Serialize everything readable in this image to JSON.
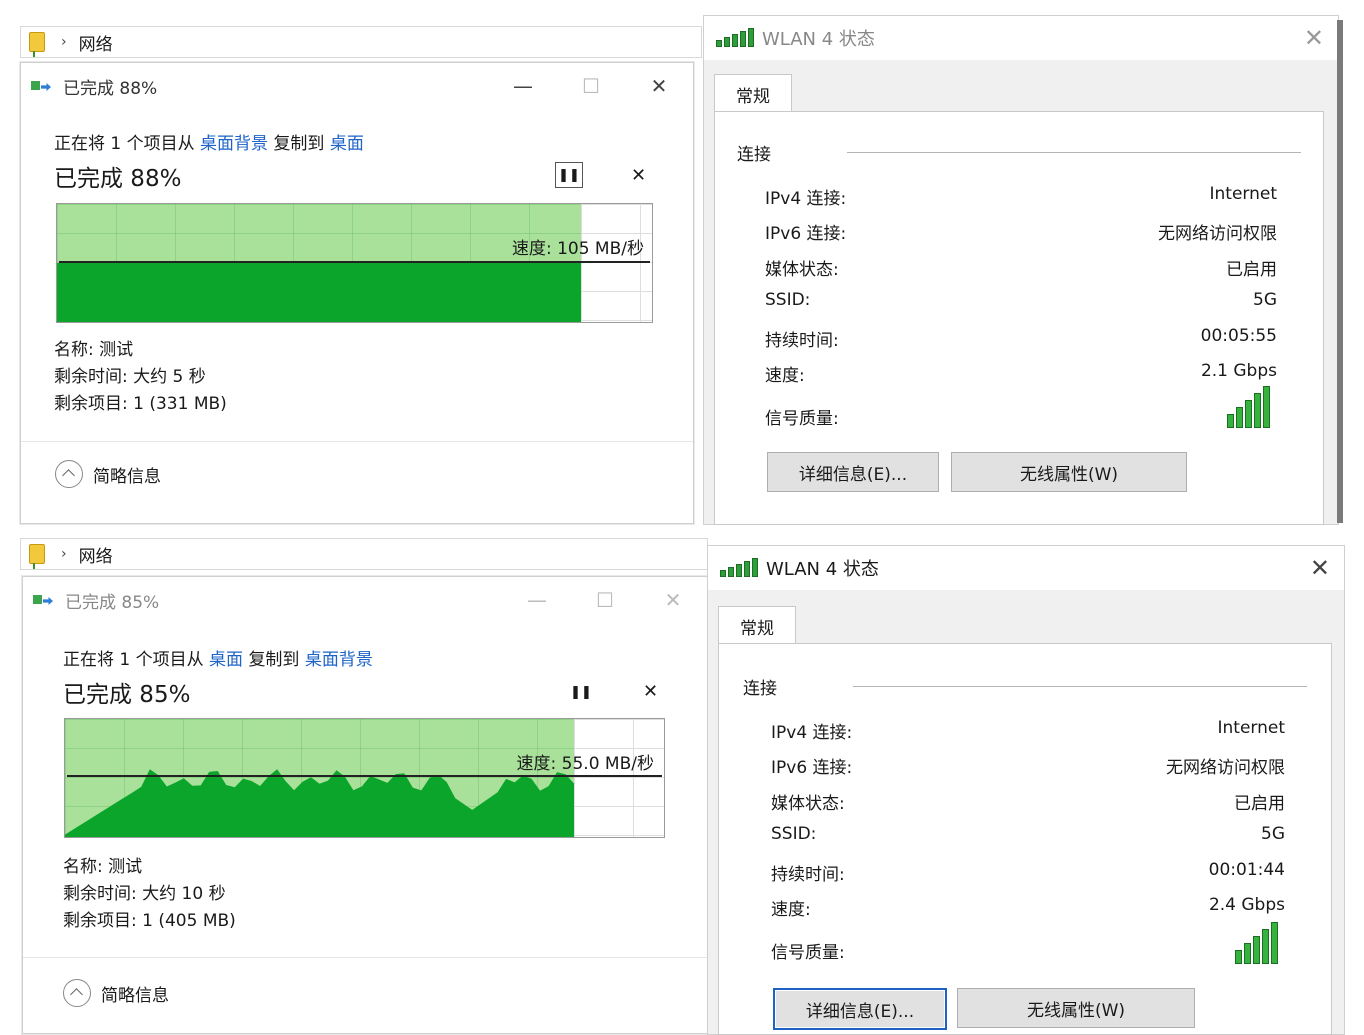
{
  "top_explorer": {
    "breadcrumb": "网络"
  },
  "bottom_explorer": {
    "breadcrumb": "网络"
  },
  "copy_top": {
    "title": "已完成 88%",
    "op_prefix": "正在将 1 个项目从",
    "source": "桌面背景",
    "op_mid": "复制到",
    "dest": "桌面",
    "progress_text": "已完成 88%",
    "progress_percent": 88,
    "speed": "速度: 105 MB/秒",
    "name": "名称: 测试",
    "time_left": "剩余时间: 大约 5 秒",
    "items_left": "剩余项目: 1 (331 MB)",
    "collapse_label": "简略信息",
    "pause_icon": "pause-icon",
    "cancel_icon": "close-icon"
  },
  "copy_bottom": {
    "title": "已完成 85%",
    "op_prefix": "正在将 1 个项目从",
    "source": "桌面",
    "op_mid": "复制到",
    "dest": "桌面背景",
    "progress_text": "已完成 85%",
    "progress_percent": 85,
    "speed": "速度: 55.0 MB/秒",
    "name": "名称: 测试",
    "time_left": "剩余时间: 大约 10 秒",
    "items_left": "剩余项目: 1 (405 MB)",
    "collapse_label": "简略信息",
    "pause_icon": "pause-icon",
    "cancel_icon": "close-icon"
  },
  "wlan_top": {
    "title": "WLAN 4 状态",
    "tab": "常规",
    "group": "连接",
    "rows": [
      {
        "label": "IPv4 连接:",
        "value": "Internet"
      },
      {
        "label": "IPv6 连接:",
        "value": "无网络访问权限"
      },
      {
        "label": "媒体状态:",
        "value": "已启用"
      },
      {
        "label": "SSID:",
        "value": "5G"
      },
      {
        "label": "持续时间:",
        "value": "00:05:55"
      },
      {
        "label": "速度:",
        "value": "2.1 Gbps"
      }
    ],
    "signal_label": "信号质量:",
    "signal_bars": 5,
    "details_button": "详细信息(E)...",
    "wireless_button": "无线属性(W)"
  },
  "wlan_bottom": {
    "title": "WLAN 4 状态",
    "tab": "常规",
    "group": "连接",
    "rows": [
      {
        "label": "IPv4 连接:",
        "value": "Internet"
      },
      {
        "label": "IPv6 连接:",
        "value": "无网络访问权限"
      },
      {
        "label": "媒体状态:",
        "value": "已启用"
      },
      {
        "label": "SSID:",
        "value": "5G"
      },
      {
        "label": "持续时间:",
        "value": "00:01:44"
      },
      {
        "label": "速度:",
        "value": "2.4 Gbps"
      }
    ],
    "signal_label": "信号质量:",
    "signal_bars": 5,
    "details_button": "详细信息(E)...",
    "wireless_button": "无线属性(W)"
  },
  "colors": {
    "graph_fill": "#0aa52a",
    "graph_light": "#a9e19a",
    "link": "#1e63c8"
  }
}
